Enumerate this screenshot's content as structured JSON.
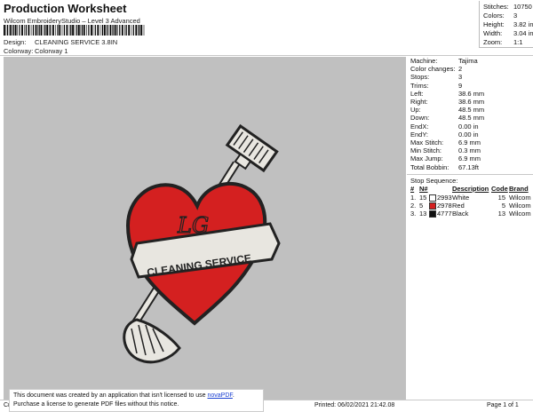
{
  "header": {
    "title": "Production Worksheet",
    "subtitle": "Wilcom EmbroideryStudio – Level 3 Advanced",
    "design_label": "Design:",
    "design_value": "CLEANING SERVICE 3.8IN",
    "colorway_label": "Colorway:",
    "colorway_value": "Colorway 1"
  },
  "stats": [
    {
      "label": "Stitches:",
      "value": "10750"
    },
    {
      "label": "Colors:",
      "value": "3"
    },
    {
      "label": "Height:",
      "value": "3.82 in"
    },
    {
      "label": "Width:",
      "value": "3.04 in"
    },
    {
      "label": "Zoom:",
      "value": "1:1"
    }
  ],
  "machine": [
    {
      "label": "Machine:",
      "value": "Tajima"
    },
    {
      "label": "Color changes:",
      "value": "2"
    },
    {
      "label": "Stops:",
      "value": "3"
    },
    {
      "label": "Trims:",
      "value": "9"
    },
    {
      "label": "Left:",
      "value": "38.6 mm"
    },
    {
      "label": "Right:",
      "value": "38.6 mm"
    },
    {
      "label": "Up:",
      "value": "48.5 mm"
    },
    {
      "label": "Down:",
      "value": "48.5 mm"
    },
    {
      "label": "EndX:",
      "value": "0.00 in"
    },
    {
      "label": "EndY:",
      "value": "0.00 in"
    },
    {
      "label": "Max Stitch:",
      "value": "6.9 mm"
    },
    {
      "label": "Min Stitch:",
      "value": "0.3 mm"
    },
    {
      "label": "Max Jump:",
      "value": "6.9 mm"
    },
    {
      "label": "Total Bobbin:",
      "value": "67.13ft"
    }
  ],
  "stop_sequence": {
    "title": "Stop Sequence:",
    "columns": [
      "#",
      "N#",
      "Description",
      "Code",
      "Brand"
    ],
    "rows": [
      {
        "num": "1.",
        "n": "15",
        "code_n": "2993",
        "desc": "White",
        "code": "15",
        "brand": "Wilcom",
        "color": "#ffffff"
      },
      {
        "num": "2.",
        "n": "5",
        "code_n": "2978",
        "desc": "Red",
        "code": "5",
        "brand": "Wilcom",
        "color": "#d42020"
      },
      {
        "num": "3.",
        "n": "13",
        "code_n": "4777",
        "desc": "Black",
        "code": "13",
        "brand": "Wilcom",
        "color": "#111111"
      }
    ]
  },
  "design_art": {
    "initials": "LG",
    "banner_text": "CLEANING SERVICE",
    "heart_color": "#d42020",
    "outline_color": "#222222",
    "banner_fill": "#e8e6e0"
  },
  "footer": {
    "left": "Cr",
    "printed": "Printed: 06/02/2021 21:42.08",
    "page": "Page 1 of 1"
  },
  "notice": {
    "line1_a": "This document was created by an application that isn't licensed to use ",
    "line1_link": "novaPDF",
    "line1_b": ".",
    "line2": "Purchase a license to generate PDF files without this notice."
  }
}
